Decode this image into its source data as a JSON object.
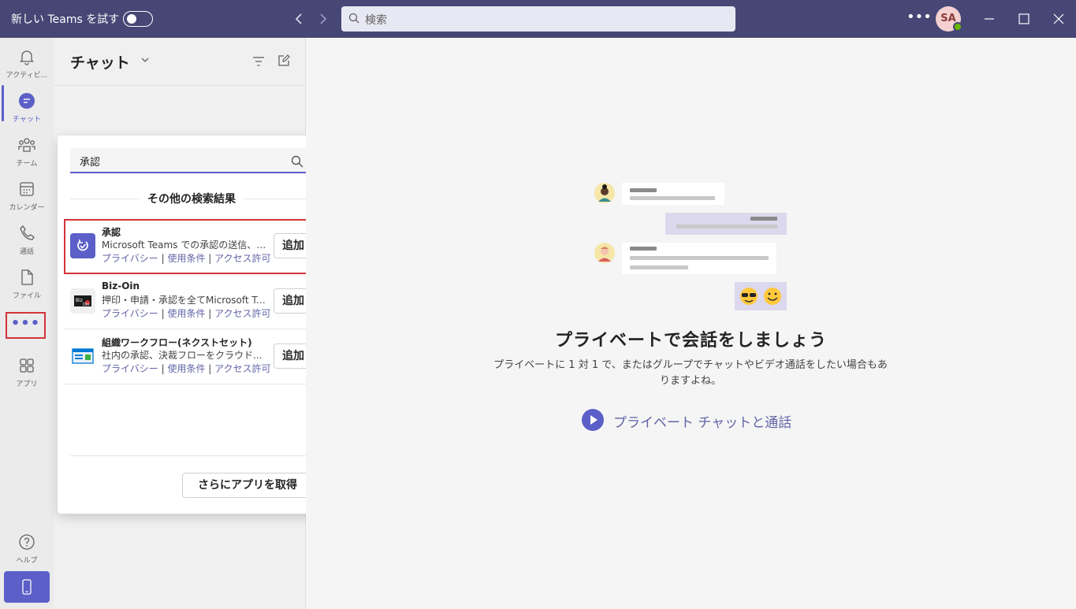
{
  "titlebar": {
    "try_label": "新しい Teams を試す",
    "search_placeholder": "検索",
    "avatar_initials": "SA"
  },
  "rail": {
    "items": [
      {
        "label": "アクティビ...",
        "icon": "bell-icon"
      },
      {
        "label": "チャット",
        "icon": "chat-icon"
      },
      {
        "label": "チーム",
        "icon": "teams-icon"
      },
      {
        "label": "カレンダー",
        "icon": "calendar-icon"
      },
      {
        "label": "通話",
        "icon": "phone-icon"
      },
      {
        "label": "ファイル",
        "icon": "file-icon"
      },
      {
        "label": "アプリ",
        "icon": "apps-icon"
      },
      {
        "label": "ヘルプ",
        "icon": "help-icon"
      }
    ],
    "more_dots": "•••"
  },
  "chat_panel": {
    "title": "チャット"
  },
  "popup": {
    "search_value": "承認",
    "section_title": "その他の検索結果",
    "apps": [
      {
        "name": "承認",
        "description": "Microsoft Teams での承認の送信、受...",
        "links": [
          "プライバシー",
          "使用条件",
          "アクセス許可"
        ],
        "add_label": "追加"
      },
      {
        "name": "Biz-Oin",
        "description": "押印・申請・承認を全てMicrosoft Tea...",
        "links": [
          "プライバシー",
          "使用条件",
          "アクセス許可"
        ],
        "add_label": "追加"
      },
      {
        "name": "組織ワークフロー(ネクストセット)",
        "description": "社内の承認、決裁フローをクラウド...",
        "links": [
          "プライバシー",
          "使用条件",
          "アクセス許可"
        ],
        "add_label": "追加"
      }
    ],
    "link_separator": " | ",
    "more_apps_label": "さらにアプリを取得"
  },
  "main": {
    "title": "プライベートで会話をしましょう",
    "description": "プライベートに 1 対 1 で、またはグループでチャットやビデオ通話をしたい場合もありますよね。",
    "link_label": "プライベート チャットと通話"
  },
  "colors": {
    "titlebar": "#464775",
    "accent": "#5b5fc7",
    "link": "#6264a7",
    "highlight_border": "#d13438"
  }
}
